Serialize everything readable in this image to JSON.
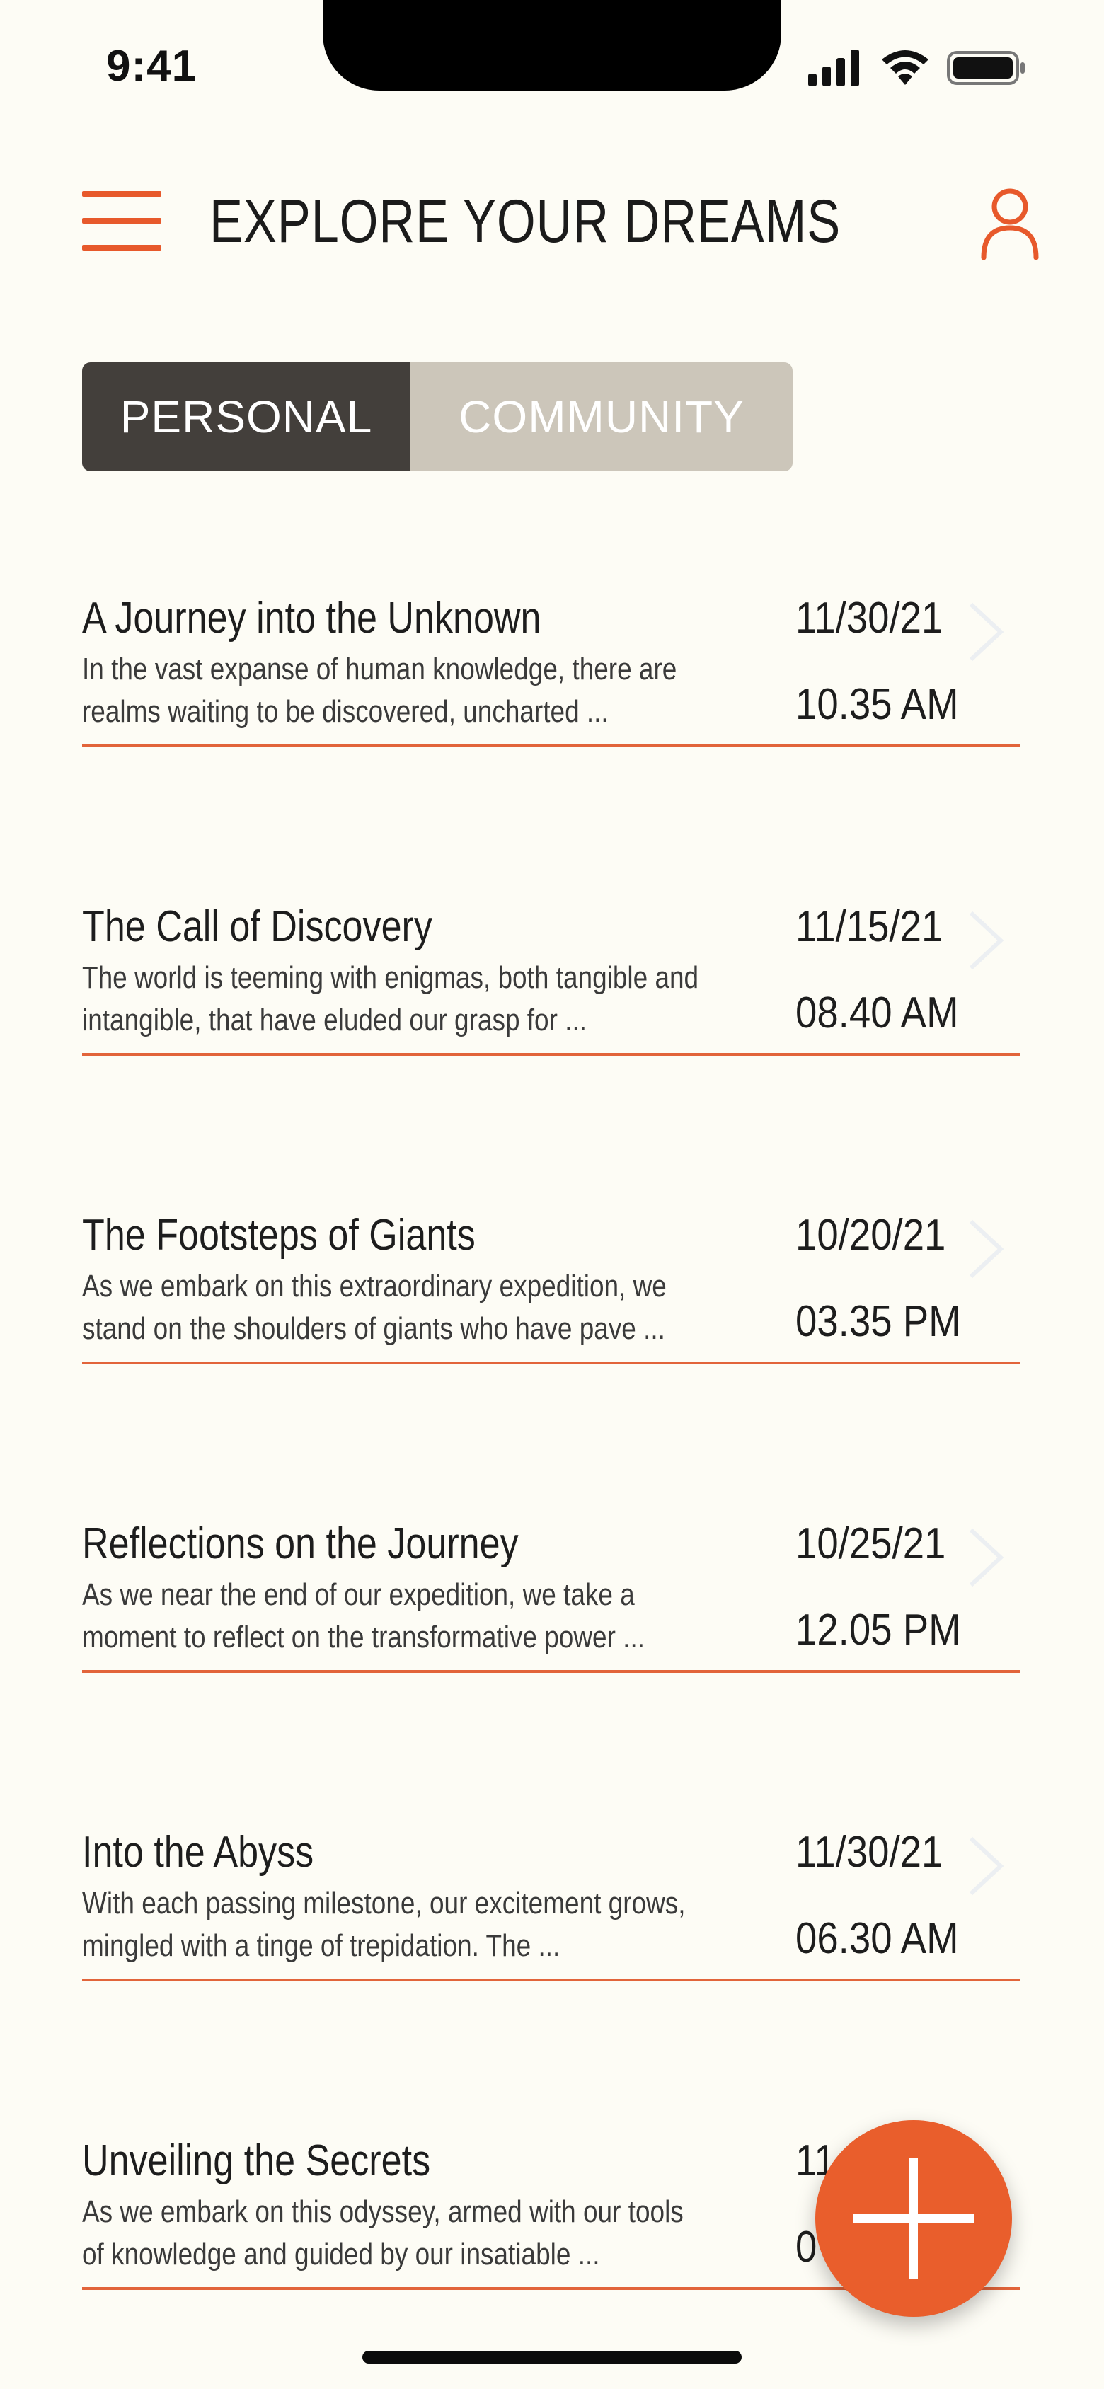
{
  "status_bar": {
    "time": "9:41"
  },
  "header": {
    "title": "EXPLORE YOUR DREAMS",
    "menu_icon": "hamburger-icon",
    "profile_icon": "user-icon"
  },
  "tabs": [
    {
      "label": "PERSONAL",
      "selected": true
    },
    {
      "label": "COMMUNITY",
      "selected": false
    }
  ],
  "entries": [
    {
      "title": "A Journey into the Unknown",
      "excerpt": "In the vast expanse of human knowledge, there are realms waiting to be discovered, uncharted ...",
      "date": "11/30/21",
      "time": "10.35 AM"
    },
    {
      "title": "The Call of Discovery",
      "excerpt": "The world is teeming with enigmas, both tangible and intangible, that have eluded our grasp for ...",
      "date": "11/15/21",
      "time": "08.40 AM"
    },
    {
      "title": "The Footsteps of Giants",
      "excerpt": "As we embark on this extraordinary expedition, we stand on the shoulders of giants who have pave ...",
      "date": "10/20/21",
      "time": "03.35 PM"
    },
    {
      "title": "Reflections on the Journey",
      "excerpt": "As we near the end of our expedition, we take a moment to reflect on the transformative power ...",
      "date": "10/25/21",
      "time": "12.05 PM"
    },
    {
      "title": "Into the Abyss",
      "excerpt": "With each passing milestone, our excitement grows, mingled with a tinge of trepidation. The ...",
      "date": "11/30/21",
      "time": "06.30 AM"
    },
    {
      "title": "Unveiling the Secrets",
      "excerpt": "As we embark on this odyssey, armed with our tools of knowledge and guided by our insatiable ...",
      "date": "11",
      "time": "0"
    }
  ],
  "fab": {
    "icon": "plus-icon"
  },
  "colors": {
    "accent": "#E95E2C",
    "background": "#FDFCF5",
    "tab_active": "#433F3B",
    "tab_inactive": "#CCC6BA"
  }
}
